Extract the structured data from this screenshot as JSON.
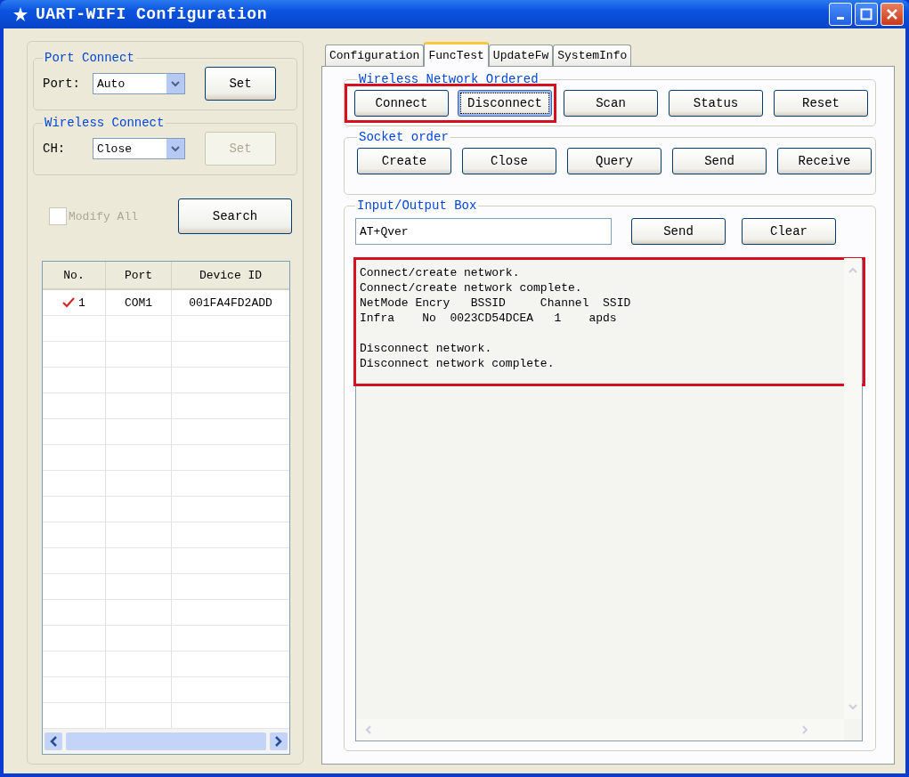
{
  "window": {
    "title": "UART-WIFI Configuration"
  },
  "port_connect": {
    "title": "Port Connect",
    "label": "Port:",
    "value": "Auto",
    "button": {
      "label": "Set",
      "disabled": false
    }
  },
  "wireless_connect": {
    "title": "Wireless Connect",
    "label": "CH:",
    "value": "Close",
    "button": {
      "label": "Set",
      "disabled": true
    }
  },
  "modify_all": {
    "label": "Modify All",
    "checked": false,
    "disabled": true
  },
  "search_button": "Search",
  "device_table": {
    "columns": [
      "No.",
      "Port",
      "Device ID"
    ],
    "rows": [
      {
        "no": "1",
        "port": "COM1",
        "device_id": "001FA4FD2ADD",
        "checked": true
      }
    ]
  },
  "tabs": [
    {
      "label": "Configuration",
      "selected": false
    },
    {
      "label": "FuncTest",
      "selected": true
    },
    {
      "label": "UpdateFw",
      "selected": false
    },
    {
      "label": "SystemInfo",
      "selected": false
    }
  ],
  "sections": [
    {
      "title": "Wireless Network Ordered",
      "button_groups": [
        {
          "highlighted": true,
          "buttons": [
            {
              "label": "Connect",
              "focused": false
            },
            {
              "label": "Disconnect",
              "focused": true
            }
          ]
        },
        {
          "highlighted": false,
          "buttons": [
            {
              "label": "Scan",
              "focused": false
            },
            {
              "label": "Status",
              "focused": false
            },
            {
              "label": "Reset",
              "focused": false
            }
          ]
        }
      ]
    },
    {
      "title": "Socket order",
      "button_groups": [
        {
          "highlighted": false,
          "buttons": [
            {
              "label": "Create",
              "focused": false
            },
            {
              "label": "Close",
              "focused": false
            },
            {
              "label": "Query",
              "focused": false
            },
            {
              "label": "Send",
              "focused": false
            },
            {
              "label": "Receive",
              "focused": false
            }
          ]
        }
      ]
    }
  ],
  "io_box": {
    "title": "Input/Output Box",
    "input": "AT+Qver",
    "buttons": [
      "Send",
      "Clear"
    ],
    "output": "Connect/create network.\nConnect/create network complete.\nNetMode Encry   BSSID     Channel  SSID\nInfra    No  0023CD54DCEA   1    apds\n\nDisconnect network.\nDisconnect network complete.",
    "output_highlighted": true
  }
}
